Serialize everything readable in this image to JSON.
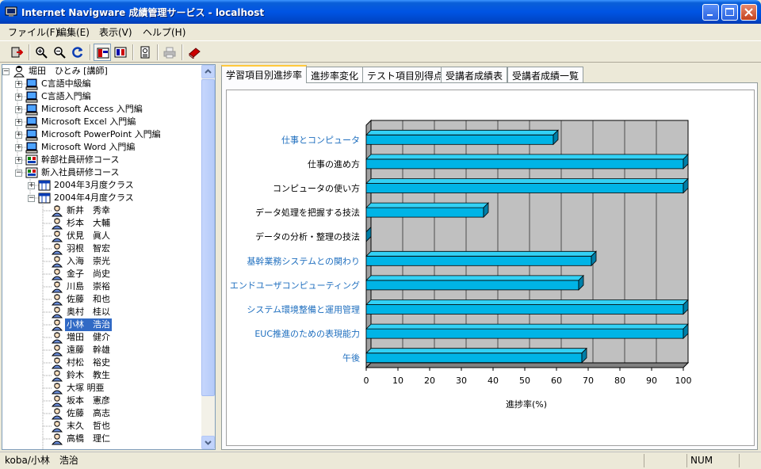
{
  "window": {
    "title": "Internet Navigware 成績管理サービス - localhost"
  },
  "menu": [
    "ファイル(F)",
    "編集(E)",
    "表示(V)",
    "ヘルプ(H)"
  ],
  "toolbar": {
    "icons": [
      "exit-icon",
      "zoom-in-icon",
      "zoom-out-icon",
      "refresh-icon",
      "layout-tree-icon",
      "layout-split-icon",
      "report-icon",
      "print-icon",
      "book-icon"
    ]
  },
  "tree": {
    "root": "堀田　ひとみ [講師]",
    "courses": [
      "C言語中級編",
      "C言語入門編",
      "Microsoft Access 入門編",
      "Microsoft Excel 入門編",
      "Microsoft PowerPoint 入門編",
      "Microsoft Word 入門編",
      "幹部社員研修コース",
      "新入社員研修コース"
    ],
    "classes": [
      "2004年3月度クラス",
      "2004年4月度クラス"
    ],
    "students": [
      "新井　秀幸",
      "杉本　大輔",
      "伏見　眞人",
      "羽根　智宏",
      "入海　崇光",
      "金子　尚史",
      "川島　崇裕",
      "佐藤　和也",
      "奥村　桂以",
      "小林　浩治",
      "増田　健介",
      "遠藤　幹雄",
      "村松　裕史",
      "鈴木　教生",
      "大塚 明亜",
      "坂本　憲彦",
      "佐藤　高志",
      "末久　哲也",
      "高橋　理仁"
    ],
    "selected_student": "小林　浩治"
  },
  "tabs": [
    "学習項目別進捗率",
    "進捗率変化",
    "テスト項目別得点",
    "受講者成績表",
    "受講者成績一覧"
  ],
  "active_tab": "学習項目別進捗率",
  "chart_data": {
    "type": "bar",
    "orientation": "horizontal",
    "categories": [
      "仕事とコンピュータ",
      "仕事の進め方",
      "コンピュータの使い方",
      "データ処理を把握する技法",
      "データの分析・整理の技法",
      "基幹業務システムとの関わり",
      "エンドユーザコンピューティング",
      "システム環境整備と運用管理",
      "EUC推進のための表現能力",
      "午後"
    ],
    "category_colors": [
      "#1f6fbf",
      "#000000",
      "#000000",
      "#000000",
      "#000000",
      "#1f6fbf",
      "#1f6fbf",
      "#1f6fbf",
      "#1f6fbf",
      "#1f6fbf"
    ],
    "values": [
      59,
      100,
      100,
      37,
      0,
      71,
      67,
      100,
      100,
      68
    ],
    "xlabel": "進捗率(%)",
    "xticks": [
      "0",
      "10",
      "20",
      "30",
      "40",
      "50",
      "60",
      "70",
      "80",
      "90",
      "100"
    ],
    "xlim": [
      0,
      100
    ],
    "grid": true,
    "bar_color": "#00b4e6",
    "background": "#c0c0c0"
  },
  "status": {
    "user": "koba/小林　浩治",
    "num": "NUM"
  }
}
